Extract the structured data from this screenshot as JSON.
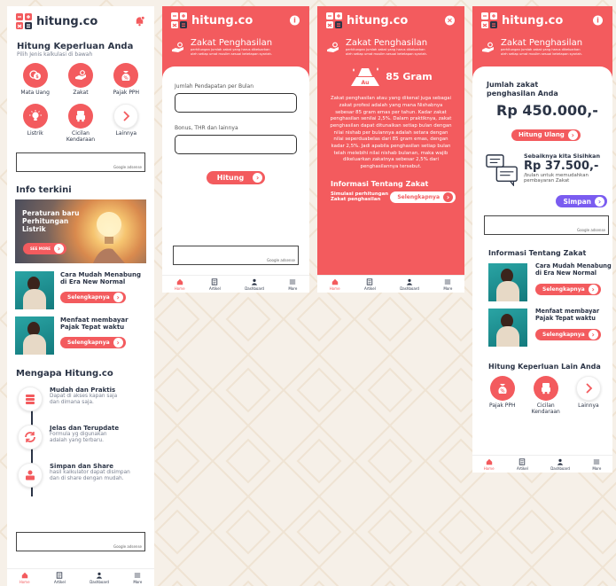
{
  "app": {
    "name": "hitung.co"
  },
  "screen_home": {
    "title": "Hitung Keperluan Anda",
    "subtitle": "Pilih Jenis kalkulasi di bawah",
    "categories": [
      {
        "label": "Mata Uang",
        "icon": "currency-icon"
      },
      {
        "label": "Zakat",
        "icon": "zakat-hand-icon"
      },
      {
        "label": "Pajak PPH",
        "icon": "tax-bag-icon"
      },
      {
        "label": "Listrik",
        "icon": "bulb-icon"
      },
      {
        "label": "Cicilan\nKendaraan",
        "icon": "vehicle-icon"
      },
      {
        "label": "Lainnya",
        "icon": "chevron-right-icon"
      }
    ],
    "ad_label": "Google adsense",
    "info_title": "Info terkini",
    "banner": {
      "title": "Peraturan baru\nPerhitungan\nListrik",
      "button": "SEE MORE"
    },
    "articles": [
      {
        "title": "Cara Mudah Menabung\ndi Era New Normal",
        "button": "Selengkapnya"
      },
      {
        "title": "Menfaat membayar\nPajak Tepat waktu",
        "button": "Selengkapnya"
      }
    ],
    "why_title": "Mengapa Hitung.co",
    "why_items": [
      {
        "title": "Mudah dan Praktis",
        "desc": "Dapat di akses kapan saja\ndan dimana saja."
      },
      {
        "title": "Jelas dan Terupdate",
        "desc": "Formula yg digunakan\nadalah yang terbaru."
      },
      {
        "title": "Simpan dan Share",
        "desc": "hasil kalkulator dapat disimpan\ndan di share dengan mudah."
      }
    ]
  },
  "screen_zakat": {
    "title": "Zakat Penghasilan",
    "subtitle": "perhitungan jumlah zakat yang harus dikeluarkan\noleh setiap umat muslim sesuai ketetapan syariah.",
    "field1_label": "Jumlah Pendapatan per Bulan",
    "field2_label": "Bonus, THR dan lainnya",
    "button": "Hitung",
    "ad_label": "Google adsense"
  },
  "screen_info": {
    "title": "Zakat Penghasilan",
    "subtitle": "perhitungan jumlah zakat yang harus dikeluarkan\noleh setiap umat muslim sesuai ketetapan syariah.",
    "gold_value": "85 Gram",
    "description": "Zakat penghasilan atau yang dikenal juga sebagai zakat profesi adalah yang mana Nishabnya sebesar 85 gram emas per tahun. Kadar zakat penghasilan senilai 2,5%. Dalam praktiknya, zakat penghasilan dapat ditunaikan setiap bulan dengan nilai nishab per bulannya adalah setara dengan nilai seperduabelas dari 85 gram emas, dengan kadar 2,5%. Jadi apabila penghasilan setiap bulan telah melebihi nilai nishab bulanan, maka wajib dikeluarkan zakatnya sebesar 2,5% dari penghasilannya tersebut.",
    "info_title": "Informasi Tentang Zakat",
    "sim_label": "Simulasi perhitungan\nZakat penghasilan",
    "button": "Selengkapnya"
  },
  "screen_result": {
    "label": "Jumlah zakat\npenghasilan Anda",
    "amount": "Rp 450.000,-",
    "recalc": "Hitung Ulang",
    "save_title": "Sebaiknya kita Sisihkan",
    "save_amount": "Rp 37.500,-",
    "save_desc": "/bulan untuk memudahkan\npembayaran Zakat",
    "save_button": "Simpan",
    "ad_label": "Google adsense",
    "info_title": "Informasi Tentang Zakat",
    "articles": [
      {
        "title": "Cara Mudah Menabung\ndi Era New Normal",
        "button": "Selengkapnya"
      },
      {
        "title": "Menfaat membayar\nPajak Tepat waktu",
        "button": "Selengkapnya"
      }
    ],
    "other_title": "Hitung Keperluan Lain Anda",
    "other_items": [
      {
        "label": "Pajak PPH",
        "icon": "tax-bag-icon"
      },
      {
        "label": "Cicilan\nKendaraan",
        "icon": "vehicle-icon"
      },
      {
        "label": "Lainnya",
        "icon": "chevron-right-icon"
      }
    ]
  },
  "nav": [
    "Home",
    "Artikel",
    "Dashboard",
    "More"
  ],
  "colors": {
    "accent": "#f35b5e",
    "text": "#2b3446",
    "muted": "#7a8191",
    "bg": "#f6f0e8"
  }
}
